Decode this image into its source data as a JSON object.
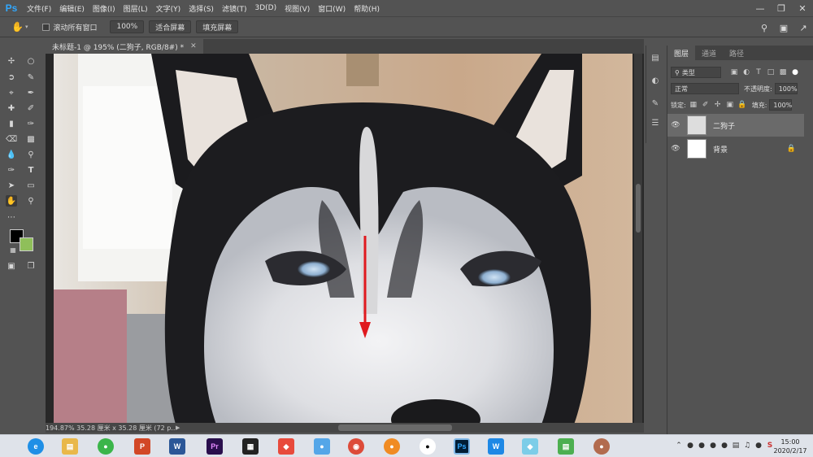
{
  "app": {
    "logo": "Ps",
    "menu": [
      "文件(F)",
      "编辑(E)",
      "图像(I)",
      "图层(L)",
      "文字(Y)",
      "选择(S)",
      "滤镜(T)",
      "3D(D)",
      "视图(V)",
      "窗口(W)",
      "帮助(H)"
    ]
  },
  "options": {
    "scroll_all_windows": "滚动所有窗口",
    "zoom": "100%",
    "fit_screen": "适合屏幕",
    "fill_screen": "填充屏幕"
  },
  "document": {
    "tab_title": "未标题-1 @ 195% (二狗子, RGB/8#) *",
    "status": "194.87% 35.28 厘米 x 35.28 厘米 (72 p..."
  },
  "layers_panel": {
    "tabs": [
      "图层",
      "通道",
      "路径"
    ],
    "kind_filter": "类型",
    "blend_mode": "正常",
    "opacity_label": "不透明度:",
    "opacity_value": "100%",
    "lock_label": "锁定:",
    "fill_label": "填充:",
    "fill_value": "100%",
    "layers": [
      {
        "name": "二狗子",
        "selected": true
      },
      {
        "name": "背景",
        "selected": false
      }
    ]
  },
  "taskbar": {
    "clock_time": "15:00",
    "clock_date": "2020/2/17"
  },
  "colors": {
    "foreground": "#000000",
    "background": "#8fbf5a",
    "annotation_arrow": "#e0191e"
  }
}
